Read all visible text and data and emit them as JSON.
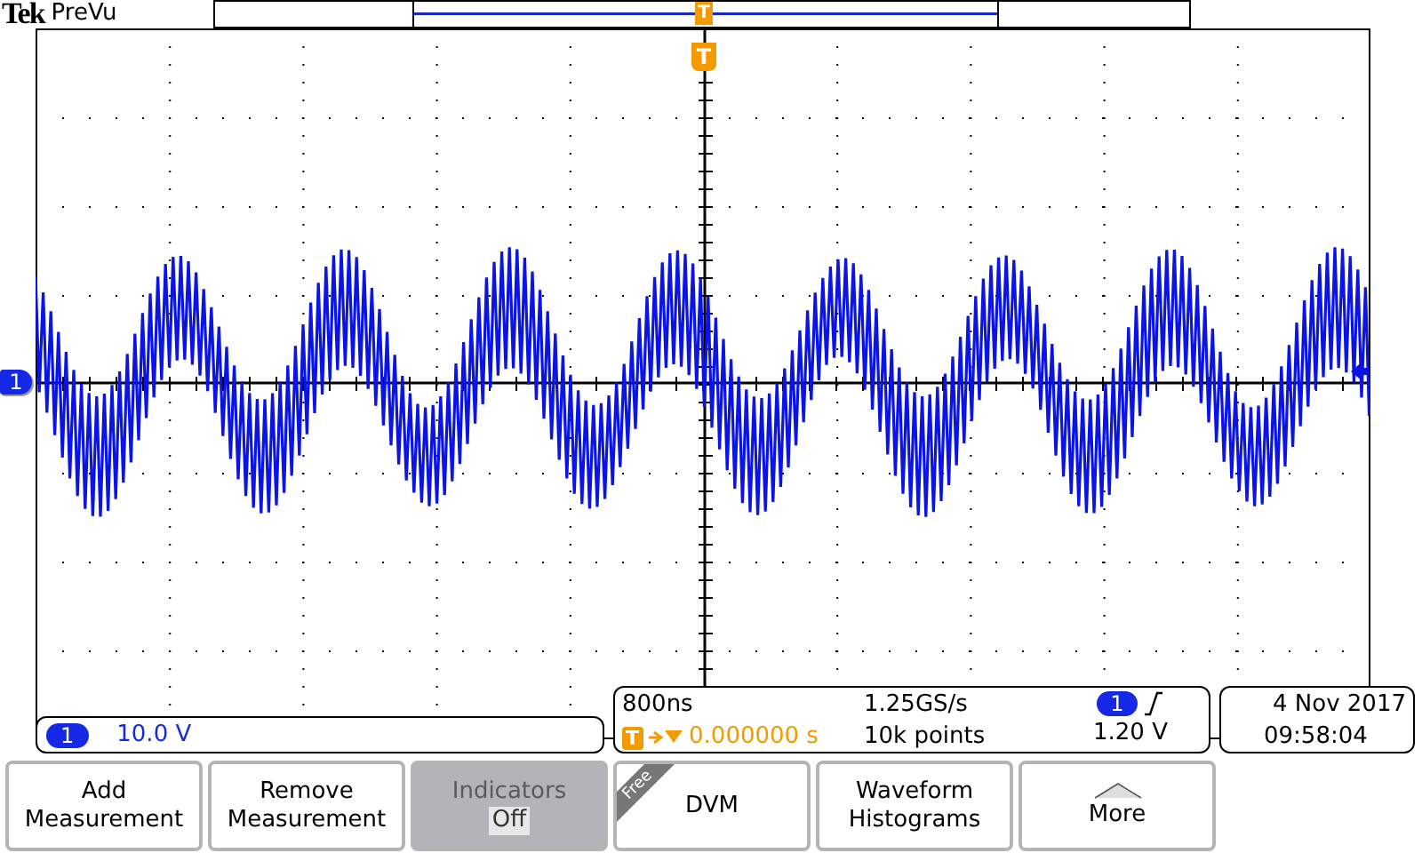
{
  "header": {
    "brand": "Tek",
    "mode": "PreVu"
  },
  "record_view": {
    "trigger_marker": "T"
  },
  "graticule": {
    "trigger_marker": "T",
    "channel_marker": "1"
  },
  "channel_readout": {
    "channel": "1",
    "scale": "10.0 V"
  },
  "horizontal_readout": {
    "time_scale": "800ns",
    "trigger_badge": "T",
    "trigger_position": "0.000000 s",
    "sample_rate": "1.25GS/s",
    "record_length": "10k points",
    "trigger_source": "1",
    "trigger_level": "1.20 V"
  },
  "clock": {
    "date": "4 Nov 2017",
    "time": "09:58:04"
  },
  "buttons": [
    {
      "kind": "plain",
      "label": "Add Measurement",
      "disabled": false
    },
    {
      "kind": "plain",
      "label": "Remove Measurement",
      "disabled": false
    },
    {
      "kind": "toggle",
      "label": "Indicators",
      "value": "Off",
      "disabled": true
    },
    {
      "kind": "tagged",
      "label": "DVM",
      "tag": "Free",
      "disabled": false
    },
    {
      "kind": "plain",
      "label": "Waveform Histograms",
      "disabled": false
    },
    {
      "kind": "menu",
      "label": "More",
      "disabled": false
    }
  ]
}
